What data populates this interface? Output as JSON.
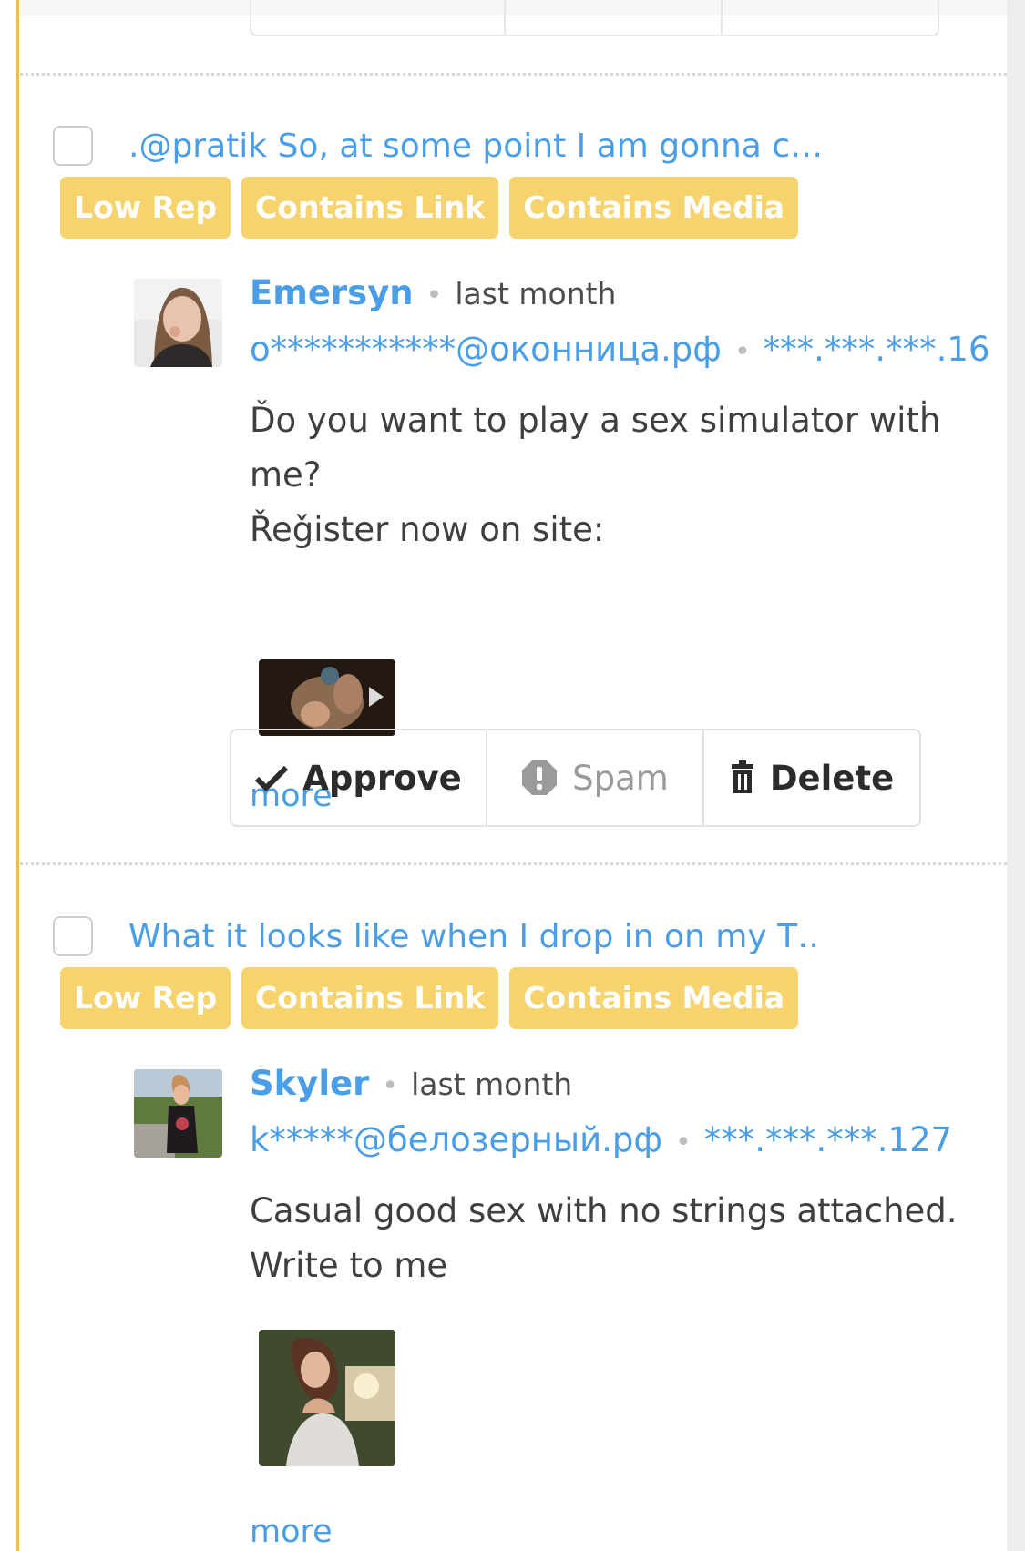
{
  "badge_color": "#f6d36c",
  "link_color": "#4a9ee8",
  "actions": {
    "approve_label": "Approve",
    "spam_label": "Spam",
    "delete_label": "Delete"
  },
  "comments": [
    {
      "subject": ".@pratik So, at some point I am gonna c…",
      "badges": [
        "Low Rep",
        "Contains Link",
        "Contains Media"
      ],
      "author": "Emersyn",
      "time": "last month",
      "email": "o***********@оконница.рф",
      "ip": "***.***.***.16",
      "body_line1": "Ďo you want to play a sex simulator witḣ me?",
      "body_line2": "Řeǧister now on site:",
      "more_label": "more"
    },
    {
      "subject": "What it looks like when I drop in on my T…",
      "badges": [
        "Low Rep",
        "Contains Link",
        "Contains Media"
      ],
      "author": "Skyler",
      "time": "last month",
      "email": "k*****@белозерный.рф",
      "ip": "***.***.***.127",
      "body_line1": "Casual good sex with no strings attached.",
      "body_line2": "Write to me",
      "more_label": "more"
    }
  ]
}
